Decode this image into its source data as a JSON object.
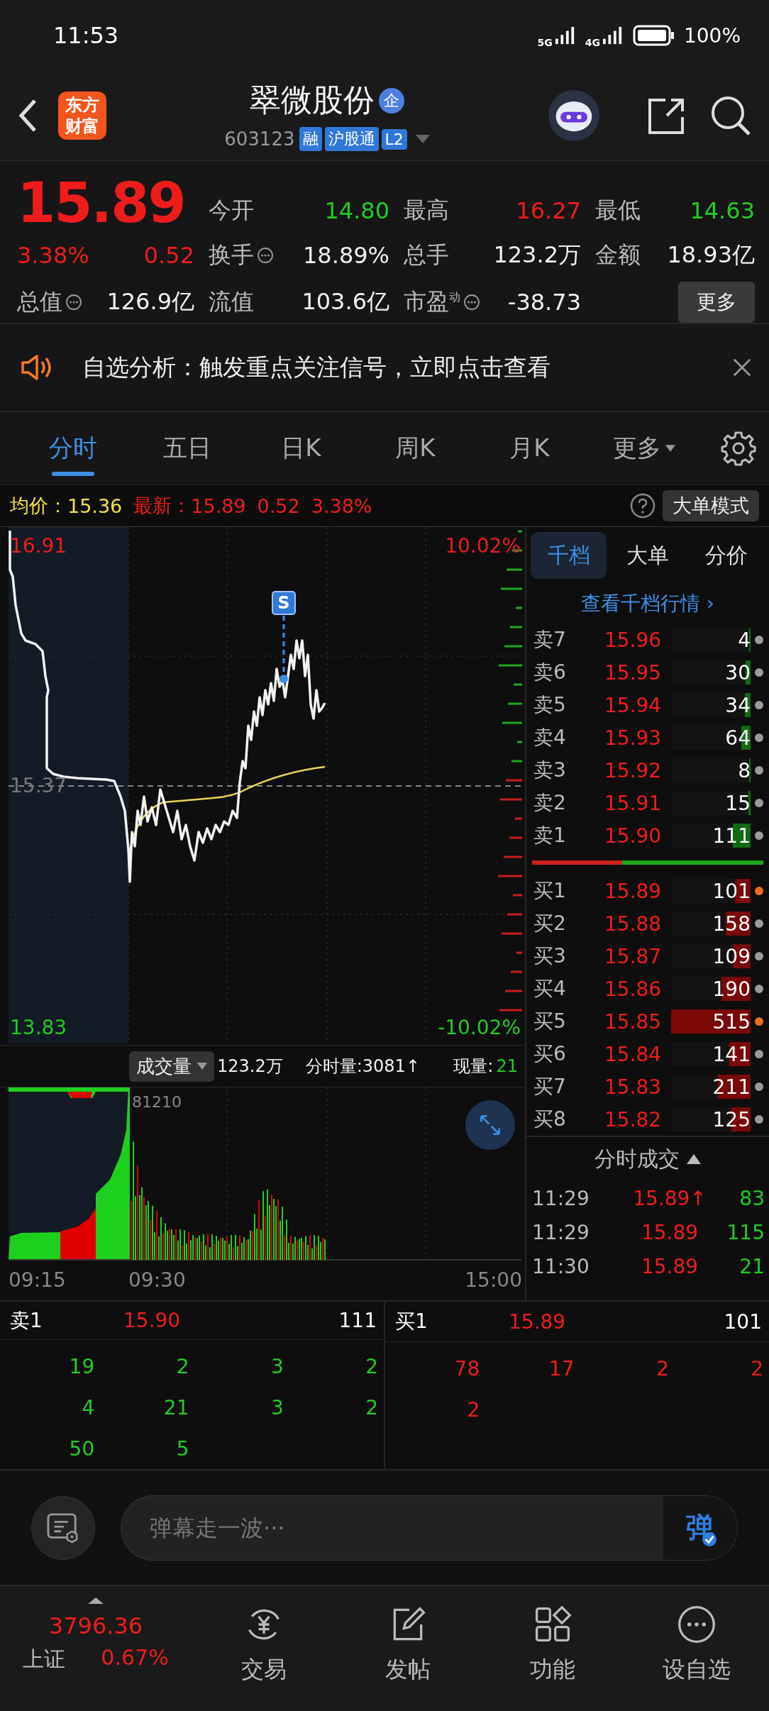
{
  "status_bar": {
    "time": "11:53",
    "networks": [
      "5G",
      "4G"
    ],
    "battery": "100%"
  },
  "header": {
    "logo": "东方财富",
    "title": "翠微股份",
    "title_badge": "企",
    "code": "603123",
    "tags": [
      "融",
      "沪股通",
      "L2"
    ]
  },
  "quote": {
    "price": "15.89",
    "change_pct": "3.38%",
    "change": "0.52",
    "more_button": "更多",
    "stats": [
      {
        "label": "今开",
        "value": "14.80",
        "info": false,
        "color": "#22cc22"
      },
      {
        "label": "最高",
        "value": "16.27",
        "info": false,
        "color": "#ee1c1c"
      },
      {
        "label": "最低",
        "value": "14.63",
        "info": false,
        "color": "#22cc22"
      },
      {
        "label": "换手",
        "value": "18.89%",
        "info": true,
        "color": "#f0f0f0"
      },
      {
        "label": "总手",
        "value": "123.2万",
        "info": false,
        "color": "#f0f0f0"
      },
      {
        "label": "金额",
        "value": "18.93亿",
        "info": false,
        "color": "#f0f0f0"
      },
      {
        "label": "总值",
        "value": "126.9亿",
        "info": true,
        "color": "#f0f0f0"
      },
      {
        "label": "流值",
        "value": "103.6亿",
        "info": false,
        "color": "#f0f0f0"
      },
      {
        "label": "市盈$^{动}$",
        "value": "-38.73",
        "info": true,
        "color": "#f0f0f0"
      }
    ]
  },
  "notice": {
    "text": "自选分析：触发重点关注信号，立即点击查看"
  },
  "tabs": [
    {
      "label": "分时",
      "selected": true,
      "kind": "tab"
    },
    {
      "label": "五日",
      "selected": false,
      "kind": "tab"
    },
    {
      "label": "日K",
      "selected": false,
      "kind": "tab"
    },
    {
      "label": "周K",
      "selected": false,
      "kind": "tab"
    },
    {
      "label": "月K",
      "selected": false,
      "kind": "tab"
    },
    {
      "label": "更多",
      "selected": false,
      "kind": "menu"
    }
  ],
  "info_line": {
    "avg_label": "均价：",
    "avg": "15.36",
    "latest_label": "最新：",
    "latest": "15.89",
    "change": "0.52",
    "change_pct": "3.38%",
    "mode_button": "大单模式"
  },
  "price_chart": {
    "top_price": "16.91",
    "mid_price": "15.37",
    "bottom_price": "13.83",
    "top_pct": "10.02%",
    "bottom_pct": "-10.02%",
    "marker": "S"
  },
  "volume": {
    "selector": "成交量",
    "total": "123.2万",
    "minute_volume": "分时量:3081↑",
    "current_label": "现量:",
    "current": "21",
    "peak": "81210",
    "times": [
      "09:15",
      "09:30",
      "15:00"
    ]
  },
  "right_panel": {
    "tabs": [
      {
        "label": "千档",
        "selected": true
      },
      {
        "label": "大单",
        "selected": false
      },
      {
        "label": "分价",
        "selected": false
      }
    ],
    "link": "查看千档行情 ›"
  },
  "order_book": {
    "sells": [
      {
        "label": "卖7",
        "price": "15.96",
        "volume": "4",
        "level": 0.02,
        "color": "#9a9a9a"
      },
      {
        "label": "卖6",
        "price": "15.95",
        "volume": "30",
        "level": 0.06,
        "color": "#9a9a9a"
      },
      {
        "label": "卖5",
        "price": "15.94",
        "volume": "34",
        "level": 0.07,
        "color": "#9a9a9a"
      },
      {
        "label": "卖4",
        "price": "15.93",
        "volume": "64",
        "level": 0.12,
        "color": "#9a9a9a"
      },
      {
        "label": "卖3",
        "price": "15.92",
        "volume": "8",
        "level": 0.02,
        "color": "#9a9a9a"
      },
      {
        "label": "卖2",
        "price": "15.91",
        "volume": "15",
        "level": 0.03,
        "color": "#9a9a9a"
      },
      {
        "label": "卖1",
        "price": "15.90",
        "volume": "111",
        "level": 0.22,
        "color": "#9a9a9a"
      }
    ],
    "ratio": {
      "level": 0.39
    },
    "buys": [
      {
        "label": "买1",
        "price": "15.89",
        "volume": "101",
        "level": 0.2,
        "color": "#f26b1d"
      },
      {
        "label": "买2",
        "price": "15.88",
        "volume": "158",
        "level": 0.31,
        "color": "#9a9a9a"
      },
      {
        "label": "买3",
        "price": "15.87",
        "volume": "109",
        "level": 0.21,
        "color": "#9a9a9a"
      },
      {
        "label": "买4",
        "price": "15.86",
        "volume": "190",
        "level": 0.37,
        "color": "#9a9a9a"
      },
      {
        "label": "买5",
        "price": "15.85",
        "volume": "515",
        "level": 1,
        "color": "#f26b1d"
      },
      {
        "label": "买6",
        "price": "15.84",
        "volume": "141",
        "level": 0.27,
        "color": "#9a9a9a"
      },
      {
        "label": "买7",
        "price": "15.83",
        "volume": "211",
        "level": 0.41,
        "color": "#9a9a9a"
      },
      {
        "label": "买8",
        "price": "15.82",
        "volume": "125",
        "level": 0.24,
        "color": "#9a9a9a"
      }
    ]
  },
  "trades": {
    "title": "分时成交",
    "rows": [
      {
        "time": "11:29",
        "price": "15.89↑",
        "volume": "83"
      },
      {
        "time": "11:29",
        "price": "15.89",
        "volume": "115"
      },
      {
        "time": "11:30",
        "price": "15.89",
        "volume": "21"
      }
    ]
  },
  "tick_detail": {
    "sell": {
      "label": "卖1",
      "price": "15.90",
      "volume": "111",
      "cells": [
        "19",
        "2",
        "3",
        "2",
        "4",
        "21",
        "3",
        "2",
        "50",
        "5"
      ]
    },
    "buy": {
      "label": "买1",
      "price": "15.89",
      "volume": "101",
      "cells": [
        "78",
        "17",
        "2",
        "2",
        "2"
      ]
    }
  },
  "danmaku": {
    "placeholder": "弹幕走一波···",
    "send_button": "弹"
  },
  "bottom_nav": {
    "index": {
      "value": "3796.36",
      "name": "上证",
      "change_pct": "0.67%"
    },
    "items": [
      {
        "label": "交易",
        "kind": "trade"
      },
      {
        "label": "发帖",
        "kind": "post"
      },
      {
        "label": "功能",
        "kind": "functions"
      },
      {
        "label": "设自选",
        "kind": "watchlist"
      }
    ]
  }
}
